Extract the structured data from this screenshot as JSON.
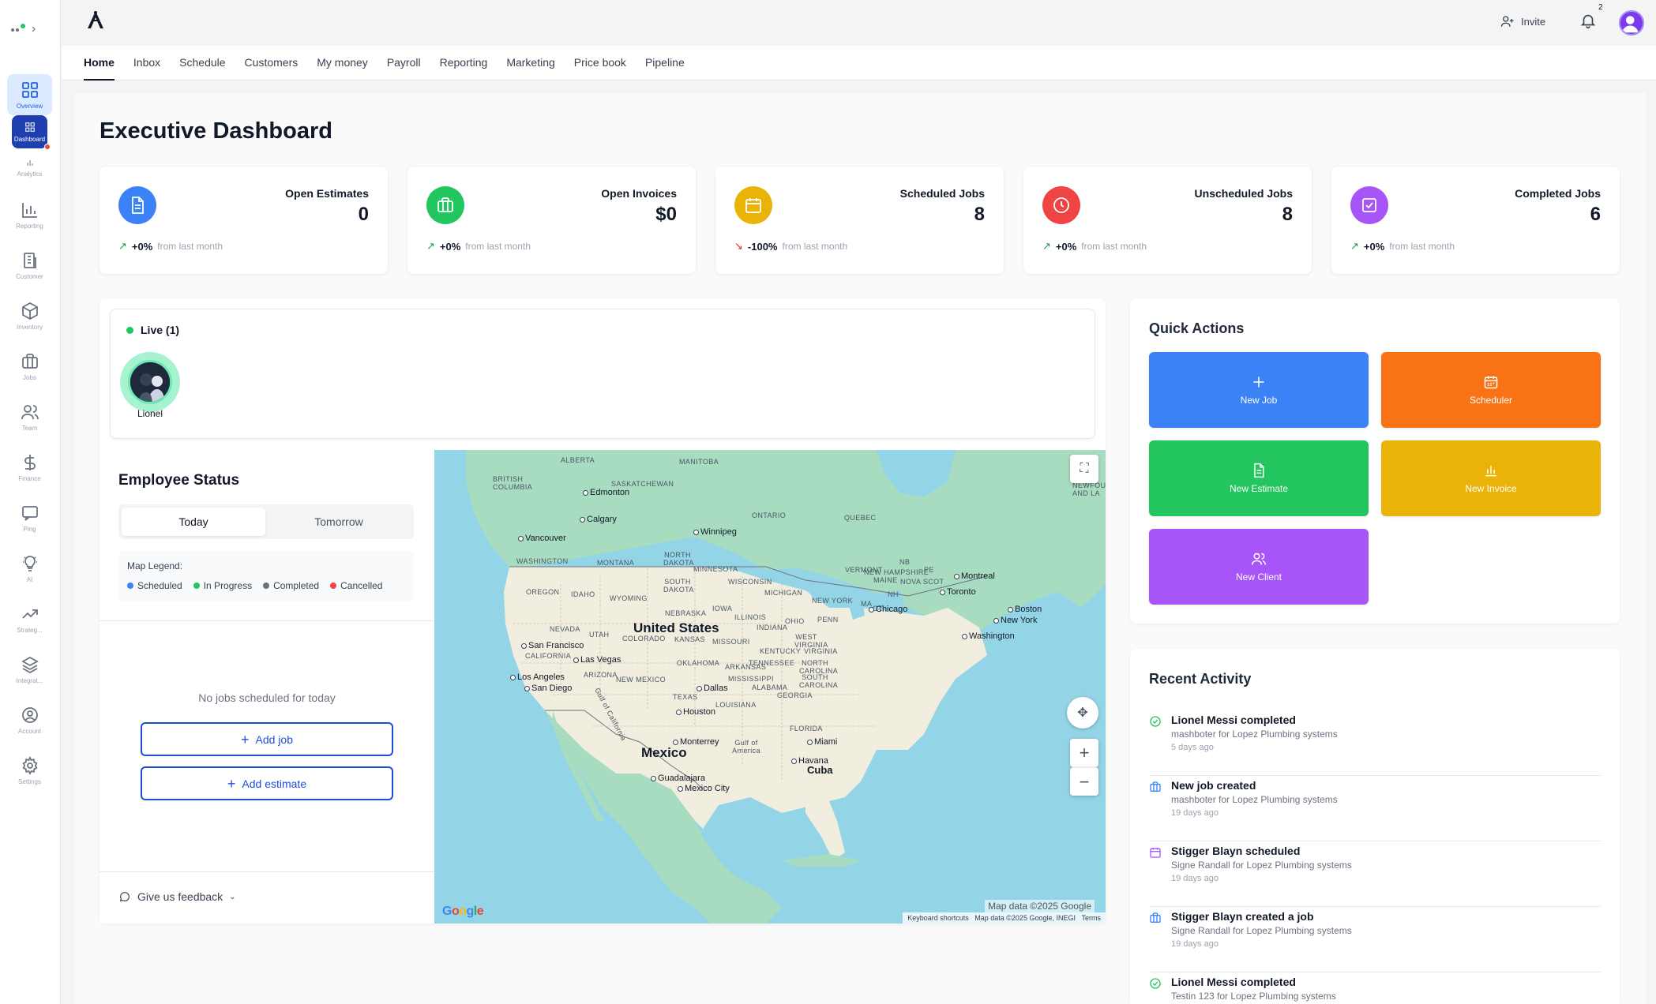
{
  "rail": {
    "items": [
      {
        "label": "Overview",
        "icon": "grid-icon"
      },
      {
        "label": "Dashboard",
        "icon": "dashboard-icon"
      },
      {
        "label": "Analytics",
        "icon": "bar-chart-icon"
      },
      {
        "label": "Reporting",
        "icon": "report-chart-icon"
      },
      {
        "label": "Customer",
        "icon": "building-icon"
      },
      {
        "label": "Inventory",
        "icon": "box-icon"
      },
      {
        "label": "Jobs",
        "icon": "briefcase-icon"
      },
      {
        "label": "Team",
        "icon": "users-icon"
      },
      {
        "label": "Finance",
        "icon": "dollar-icon"
      },
      {
        "label": "Ping",
        "icon": "chat-icon"
      },
      {
        "label": "AI",
        "icon": "lightbulb-icon"
      },
      {
        "label": "Strateg...",
        "icon": "trend-icon"
      },
      {
        "label": "Integrat...",
        "icon": "layers-icon"
      },
      {
        "label": "Account",
        "icon": "user-circle-icon"
      },
      {
        "label": "Settings",
        "icon": "gear-icon"
      }
    ]
  },
  "topbar": {
    "invite_label": "Invite",
    "notification_count": "2"
  },
  "nav": {
    "tabs": [
      "Home",
      "Inbox",
      "Schedule",
      "Customers",
      "My money",
      "Payroll",
      "Reporting",
      "Marketing",
      "Price book",
      "Pipeline"
    ],
    "active": "Home"
  },
  "page": {
    "title": "Executive Dashboard"
  },
  "stats": [
    {
      "title": "Open Estimates",
      "value": "0",
      "delta": "+0%",
      "delta_sub": "from last month",
      "trend": "up",
      "color": "#3b82f6",
      "icon": "document-icon"
    },
    {
      "title": "Open Invoices",
      "value": "$0",
      "delta": "+0%",
      "delta_sub": "from last month",
      "trend": "up",
      "color": "#22c55e",
      "icon": "briefcase-icon"
    },
    {
      "title": "Scheduled Jobs",
      "value": "8",
      "delta": "-100%",
      "delta_sub": "from last month",
      "trend": "down",
      "color": "#eab308",
      "icon": "calendar-icon"
    },
    {
      "title": "Unscheduled Jobs",
      "value": "8",
      "delta": "+0%",
      "delta_sub": "from last month",
      "trend": "up",
      "color": "#ef4444",
      "icon": "clock-icon"
    },
    {
      "title": "Completed Jobs",
      "value": "6",
      "delta": "+0%",
      "delta_sub": "from last month",
      "trend": "up",
      "color": "#a855f7",
      "icon": "check-square-icon"
    }
  ],
  "live": {
    "label": "Live (1)",
    "people": [
      {
        "name": "Lionel"
      }
    ]
  },
  "employee_status": {
    "title": "Employee Status",
    "toggle": {
      "today": "Today",
      "tomorrow": "Tomorrow"
    },
    "legend_title": "Map Legend:",
    "legend": [
      {
        "label": "Scheduled",
        "color": "#3b82f6"
      },
      {
        "label": "In Progress",
        "color": "#22c55e"
      },
      {
        "label": "Completed",
        "color": "#6b7280"
      },
      {
        "label": "Cancelled",
        "color": "#ef4444"
      }
    ],
    "empty_text": "No jobs scheduled for today",
    "add_job": "Add job",
    "add_estimate": "Add estimate",
    "feedback": "Give us feedback"
  },
  "map": {
    "regions": [
      "ALBERTA",
      "MANITOBA",
      "BRITISH COLUMBIA",
      "SASKATCHEWAN",
      "ONTARIO",
      "QUEBEC",
      "NEWFOUNDLAND AND LA",
      "WASHINGTON",
      "MONTANA",
      "NORTH DAKOTA",
      "MINNESOTA",
      "OREGON",
      "IDAHO",
      "WYOMING",
      "SOUTH DAKOTA",
      "WISCONSIN",
      "MICHIGAN",
      "NEW YORK",
      "VERMONT",
      "NEW HAMPSHIRE",
      "MAINE",
      "NOVA SCOT",
      "NB",
      "PE",
      "NEBRASKA",
      "IOWA",
      "ILLINOIS",
      "INDIANA",
      "OHIO",
      "PENN",
      "NEVADA",
      "UTAH",
      "COLORADO",
      "KANSAS",
      "MISSOURI",
      "KENTUCKY",
      "WEST VIRGINIA",
      "VIRGINIA",
      "CALIFORNIA",
      "ARIZONA",
      "NEW MEXICO",
      "OKLAHOMA",
      "ARKANSAS",
      "TENNESSEE",
      "NORTH CAROLINA",
      "SOUTH CAROLINA",
      "MISSISSIPPI",
      "ALABAMA",
      "GEORGIA",
      "TEXAS",
      "LOUISIANA",
      "FLORIDA",
      "MA",
      "CT",
      "NH",
      "Gulf of California",
      "Gulf of America"
    ],
    "cities": [
      "Edmonton",
      "Calgary",
      "Winnipeg",
      "Vancouver",
      "Montreal",
      "Toronto",
      "Boston",
      "New York",
      "Chicago",
      "Washington",
      "San Francisco",
      "Las Vegas",
      "Los Angeles",
      "San Diego",
      "Dallas",
      "Houston",
      "Miami",
      "Monterrey",
      "Havana",
      "Guadalajara",
      "Mexico City"
    ],
    "countries": [
      "United States",
      "Mexico",
      "Cuba"
    ],
    "data_label": "Map data ©2025 Google",
    "footer": [
      "Keyboard shortcuts",
      "Map data ©2025 Google, INEGI",
      "Terms"
    ],
    "brand": "Google"
  },
  "quick_actions": {
    "title": "Quick Actions",
    "buttons": [
      {
        "label": "New Job",
        "color": "#3b82f6",
        "icon": "plus-icon"
      },
      {
        "label": "Scheduler",
        "color": "#f97316",
        "icon": "calendar-icon"
      },
      {
        "label": "New Estimate",
        "color": "#22c55e",
        "icon": "document-icon"
      },
      {
        "label": "New Invoice",
        "color": "#eab308",
        "icon": "bar-chart-icon"
      },
      {
        "label": "New Client",
        "color": "#a855f7",
        "icon": "users-icon"
      }
    ]
  },
  "recent_activity": {
    "title": "Recent Activity",
    "items": [
      {
        "title": "Lionel Messi completed",
        "sub": "mashboter for Lopez Plumbing systems",
        "when": "5 days ago",
        "icon": "check-circle-icon",
        "color": "#22c55e"
      },
      {
        "title": "New job created",
        "sub": "mashboter for Lopez Plumbing systems",
        "when": "19 days ago",
        "icon": "briefcase-icon",
        "color": "#3b82f6"
      },
      {
        "title": "Stigger Blayn scheduled",
        "sub": "Signe Randall for Lopez Plumbing systems",
        "when": "19 days ago",
        "icon": "calendar-icon",
        "color": "#a855f7"
      },
      {
        "title": "Stigger Blayn created a job",
        "sub": "Signe Randall for Lopez Plumbing systems",
        "when": "19 days ago",
        "icon": "briefcase-icon",
        "color": "#3b82f6"
      },
      {
        "title": "Lionel Messi completed",
        "sub": "Testin 123 for Lopez Plumbing systems",
        "when": "",
        "icon": "check-circle-icon",
        "color": "#22c55e"
      }
    ]
  }
}
